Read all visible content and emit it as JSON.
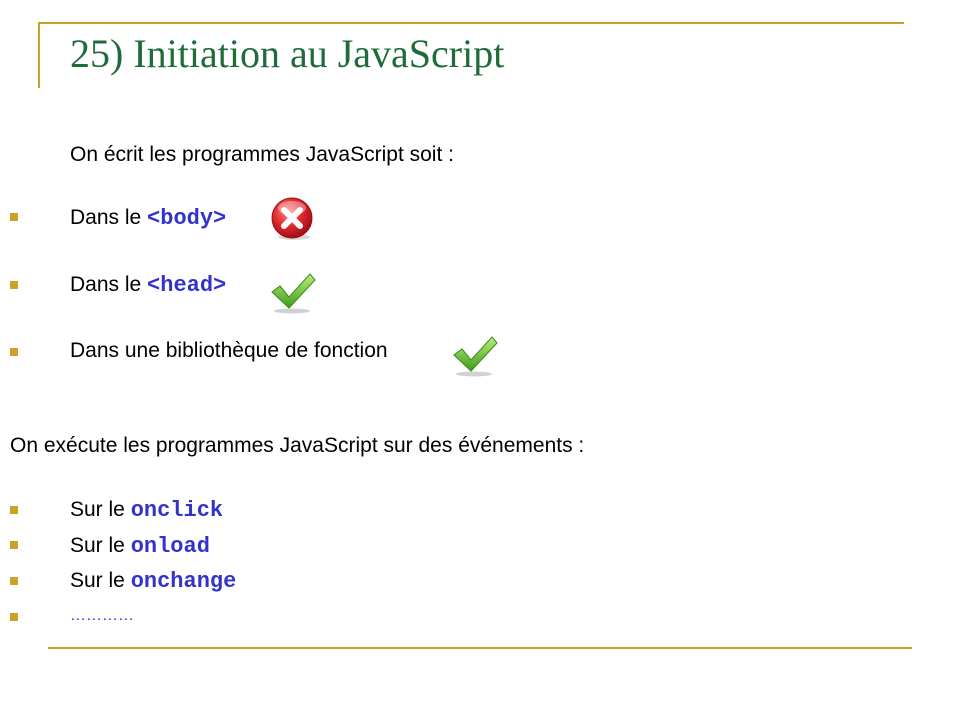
{
  "slide": {
    "title": "25) Initiation au JavaScript",
    "intro": "On écrit les programmes JavaScript soit :",
    "write_items": [
      {
        "prefix": "Dans le ",
        "code": "<body>",
        "status": "x-icon"
      },
      {
        "prefix": "Dans le ",
        "code": "<head>",
        "status": "check-icon"
      },
      {
        "prefix": "Dans une bibliothèque de fonction",
        "code": "",
        "status": "check-icon"
      }
    ],
    "exec_intro": "On exécute les programmes JavaScript sur des événements :",
    "event_items": [
      {
        "prefix": "Sur le ",
        "code": "onclick"
      },
      {
        "prefix": "Sur le ",
        "code": "onload"
      },
      {
        "prefix": "Sur le ",
        "code": "onchange"
      },
      {
        "prefix": "",
        "code": "…………"
      }
    ]
  },
  "colors": {
    "title": "#1f6b3a",
    "rule": "#c9a227",
    "code": "#3333cc",
    "bullet": "#c9a227",
    "check": "#5cb82e",
    "cross": "#e0282e"
  }
}
